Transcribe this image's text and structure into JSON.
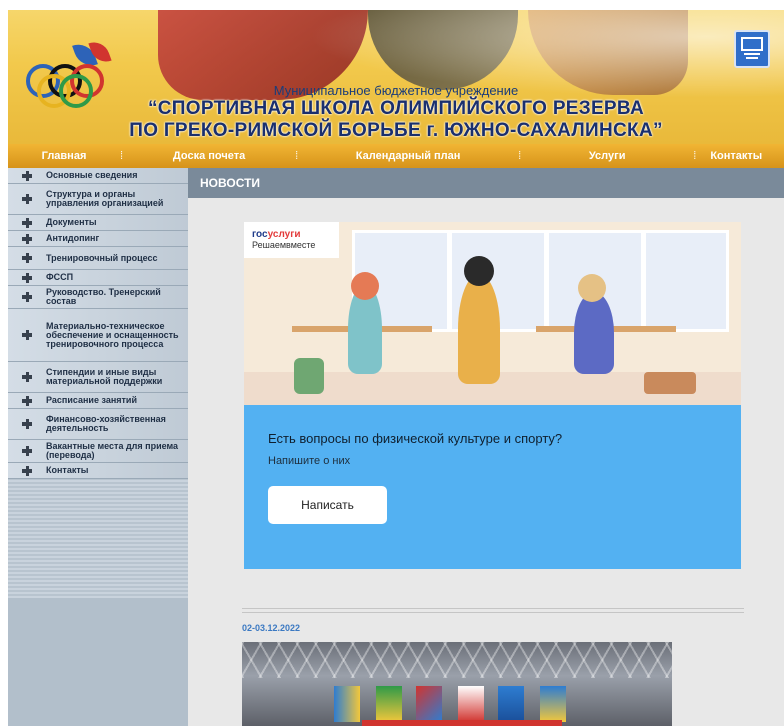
{
  "header": {
    "subtitle": "Муниципальное бюджетное учреждение",
    "title_line1": "“СПОРТИВНАЯ ШКОЛА ОЛИМПИЙСКОГО РЕЗЕРВА",
    "title_line2": "ПО ГРЕКО-РИМСКОЙ БОРЬБЕ г. ЮЖНО-САХАЛИНСКА”",
    "emblem_icon": "city-emblem-icon",
    "logo_icon": "olympic-rings-icon"
  },
  "nav": {
    "items": [
      {
        "label": "Главная"
      },
      {
        "label": "Доска почета"
      },
      {
        "label": "Календарный план"
      },
      {
        "label": "Услуги"
      },
      {
        "label": "Контакты"
      }
    ]
  },
  "sidebar": {
    "items": [
      {
        "label": "Основные сведения"
      },
      {
        "label": "Структура и органы управления организацией"
      },
      {
        "label": "Документы"
      },
      {
        "label": "Антидопинг"
      },
      {
        "label": "Тренировочный процесс"
      },
      {
        "label": "ФССП"
      },
      {
        "label": "Руководство. Тренерский состав"
      },
      {
        "label": "Материально-техническое обеспечение и оснащенность тренировочного процесса"
      },
      {
        "label": "Стипендии и иные виды материальной поддержки"
      },
      {
        "label": "Расписание занятий"
      },
      {
        "label": "Финансово-хозяйственная деятельность"
      },
      {
        "label": "Вакантные места для приема (перевода)"
      },
      {
        "label": "Контакты"
      }
    ]
  },
  "content": {
    "section_title": "НОВОСТИ",
    "promo": {
      "brand_gos": "гос",
      "brand_uslugi": "услуги",
      "brand_sub": "Решаемвместе",
      "question": "Есть вопросы по физической культуре и спорту?",
      "hint": "Напишите о них",
      "button": "Написать"
    },
    "news_date": "02-03.12.2022"
  },
  "colors": {
    "nav": "#e2a325",
    "sidebar": "#c2cdd8",
    "content_header": "#7a8a9a",
    "promo_blue": "#53b1f2",
    "date_link": "#3b79c2"
  }
}
